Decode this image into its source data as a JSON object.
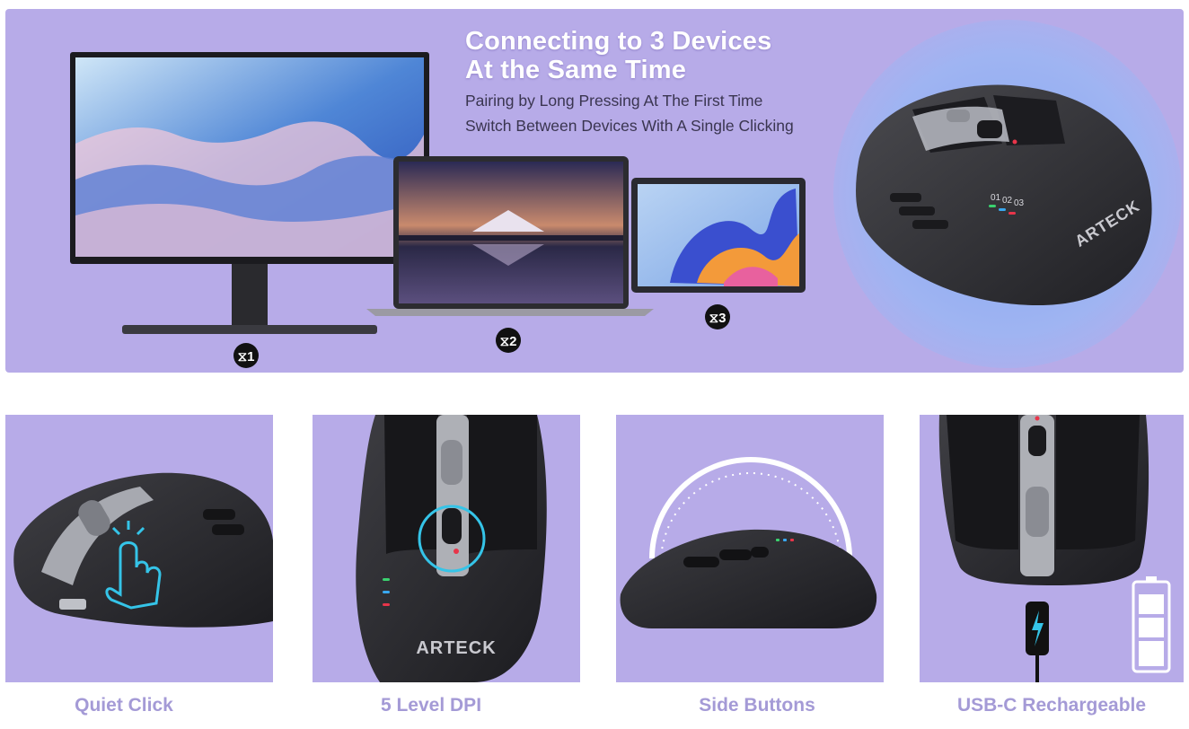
{
  "hero": {
    "headline_line1": "Connecting to 3 Devices",
    "headline_line2": "At the Same Time",
    "subline1": "Pairing by Long Pressing At The First Time",
    "subline2": "Switch Between Devices With A Single Clicking",
    "devices": [
      {
        "name": "monitor",
        "channel": "1"
      },
      {
        "name": "laptop",
        "channel": "2"
      },
      {
        "name": "tablet",
        "channel": "3"
      }
    ],
    "mouse_brand": "ARTECK",
    "leds": [
      "01",
      "02",
      "03"
    ]
  },
  "features": [
    {
      "caption": "Quiet Click"
    },
    {
      "caption": "5 Level DPI",
      "brand": "ARTECK"
    },
    {
      "caption": "Side Buttons"
    },
    {
      "caption": "USB-C Rechargeable"
    }
  ],
  "colors": {
    "lavender": "#b7abe8",
    "caption": "#a49ad6",
    "accent_cyan": "#35c4e8",
    "led_green": "#3bd16f",
    "led_blue": "#39a8f0",
    "led_red": "#e8354a"
  }
}
